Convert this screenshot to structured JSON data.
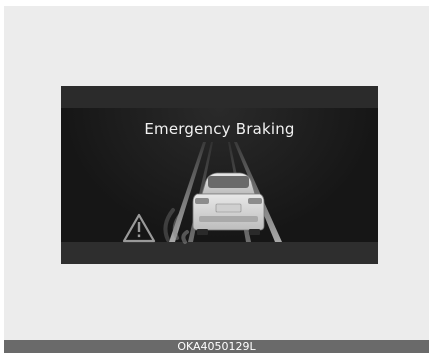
{
  "display": {
    "title": "Emergency Braking",
    "warning_icon": "warning-triangle-icon",
    "vehicle_icon": "vehicle-rear-icon",
    "colors": {
      "background": "#1c1c1c",
      "text": "#f2f2f2",
      "lane": "#9a9a9a"
    }
  },
  "caption": {
    "code": "OKA4050129L"
  }
}
